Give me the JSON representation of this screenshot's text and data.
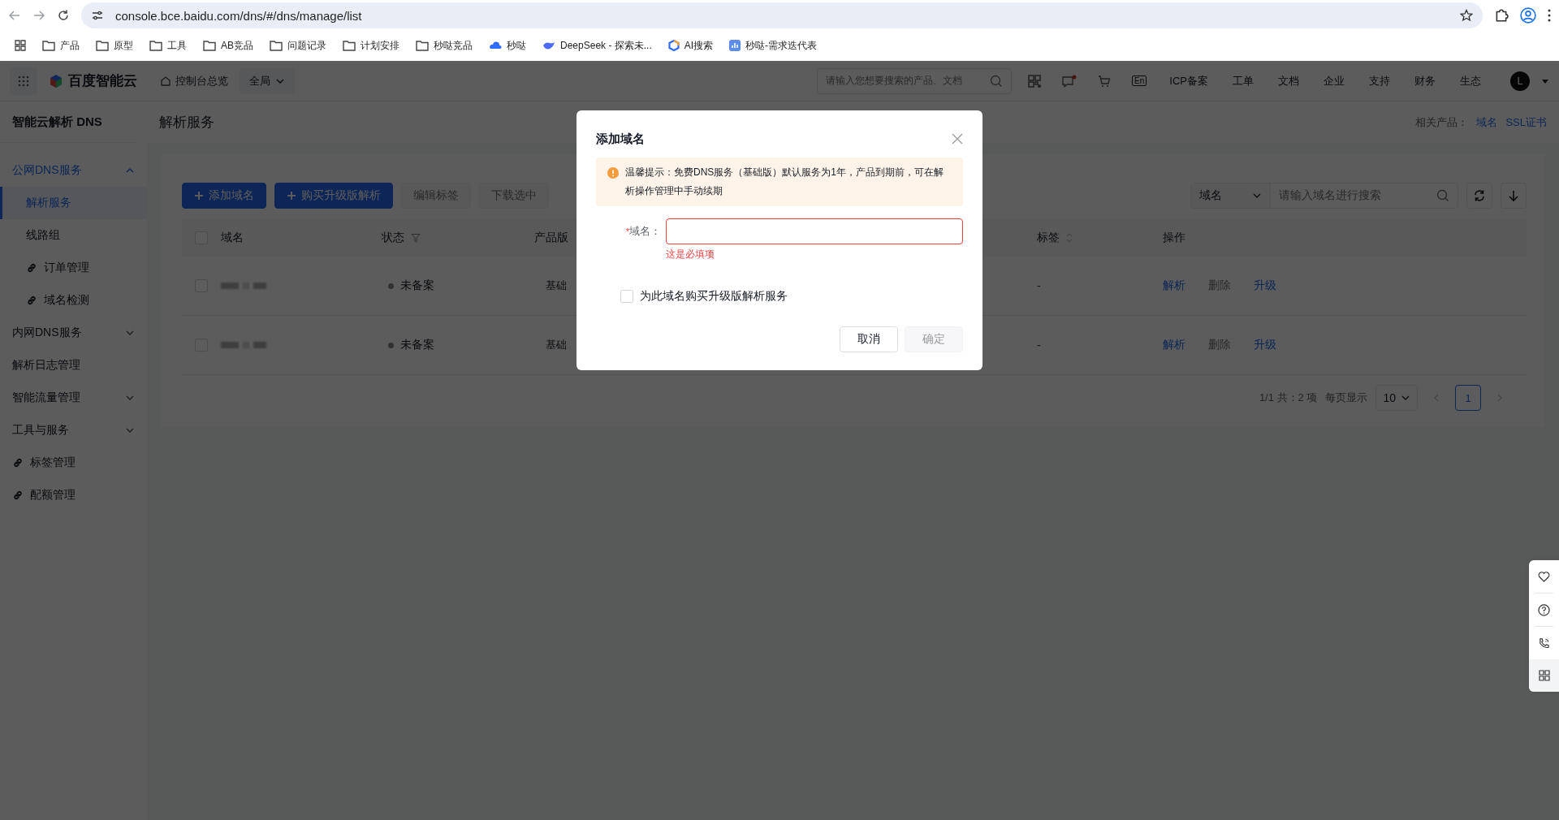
{
  "browser": {
    "url": "console.bce.baidu.com/dns/#/dns/manage/list",
    "bookmarks": [
      {
        "kind": "folder",
        "label": "产品"
      },
      {
        "kind": "folder",
        "label": "原型"
      },
      {
        "kind": "folder",
        "label": "工具"
      },
      {
        "kind": "folder",
        "label": "AB竞品"
      },
      {
        "kind": "folder",
        "label": "问题记录"
      },
      {
        "kind": "folder",
        "label": "计划安排"
      },
      {
        "kind": "folder",
        "label": "秒哒竞品"
      },
      {
        "kind": "cloud",
        "label": "秒哒"
      },
      {
        "kind": "whale",
        "label": "DeepSeek - 探索未..."
      },
      {
        "kind": "hexagon",
        "label": "AI搜索"
      },
      {
        "kind": "chart",
        "label": "秒哒-需求迭代表"
      }
    ]
  },
  "header": {
    "logo": "百度智能云",
    "home": "控制台总览",
    "region": "全局",
    "search_placeholder": "请输入您想要搜索的产品、文档",
    "lang": "En",
    "links": [
      "ICP备案",
      "工单",
      "文档",
      "企业",
      "支持",
      "财务",
      "生态"
    ],
    "avatar": "L"
  },
  "sidebar": {
    "title": "智能云解析 DNS",
    "items": [
      {
        "kind": "group",
        "label": "公网DNS服务",
        "expanded": true,
        "children": [
          {
            "kind": "item",
            "label": "解析服务",
            "selected": true
          },
          {
            "kind": "item",
            "label": "线路组",
            "selected": false
          },
          {
            "kind": "link",
            "label": "订单管理",
            "selected": false
          },
          {
            "kind": "link",
            "label": "域名检测",
            "selected": false
          }
        ]
      },
      {
        "kind": "group",
        "label": "内网DNS服务",
        "expanded": false
      },
      {
        "kind": "item",
        "label": "解析日志管理",
        "selected": false
      },
      {
        "kind": "group",
        "label": "智能流量管理",
        "expanded": false
      },
      {
        "kind": "group",
        "label": "工具与服务",
        "expanded": false
      },
      {
        "kind": "link",
        "label": "标签管理",
        "selected": false
      },
      {
        "kind": "link",
        "label": "配额管理",
        "selected": false
      }
    ]
  },
  "page": {
    "title": "解析服务",
    "related_label": "相关产品：",
    "related_links": [
      "域名",
      "SSL证书"
    ]
  },
  "toolbar": {
    "buttons": [
      {
        "label": "添加域名",
        "kind": "primary",
        "disabled": false
      },
      {
        "label": "购买升级版解析",
        "kind": "primary",
        "disabled": false
      },
      {
        "label": "编辑标签",
        "kind": "plain",
        "disabled": true
      },
      {
        "label": "下载选中",
        "kind": "plain",
        "disabled": true
      }
    ],
    "search_field": "域名",
    "search_placeholder": "请输入域名进行搜索"
  },
  "table": {
    "header_checked": false,
    "columns": [
      {
        "label": "域名",
        "kind": "plain"
      },
      {
        "label": "状态",
        "kind": "filter"
      },
      {
        "label": "产品版",
        "kind": "plain"
      },
      {
        "label": "标签",
        "kind": "sort"
      },
      {
        "label": "操作",
        "kind": "plain"
      }
    ],
    "rows": [
      {
        "checked": false,
        "status": "未备案",
        "version": "基础",
        "tag": "-",
        "actions": [
          {
            "label": "解析",
            "disabled": false
          },
          {
            "label": "删除",
            "disabled": true
          },
          {
            "label": "升级",
            "disabled": false
          }
        ]
      },
      {
        "checked": false,
        "status": "未备案",
        "version": "基础",
        "tag": "-",
        "actions": [
          {
            "label": "解析",
            "disabled": false
          },
          {
            "label": "删除",
            "disabled": true
          },
          {
            "label": "升级",
            "disabled": false
          }
        ]
      }
    ]
  },
  "pagination": {
    "summary": "1/1 共：2 项",
    "per_page_label": "每页显示",
    "per_page": "10",
    "pages": [
      {
        "label": "1",
        "selected": true
      }
    ]
  },
  "dialog": {
    "title": "添加域名",
    "alert": "温馨提示：免费DNS服务（基础版）默认服务为1年，产品到期前，可在解析操作管理中手动续期",
    "field_label": "域名：",
    "required_mark": "*",
    "error": "这是必填项",
    "checkbox_label": "为此域名购买升级版解析服务",
    "checkbox_checked": false,
    "buttons": [
      {
        "label": "取消",
        "kind": "default",
        "disabled": false
      },
      {
        "label": "确定",
        "kind": "primary",
        "disabled": true
      }
    ]
  }
}
